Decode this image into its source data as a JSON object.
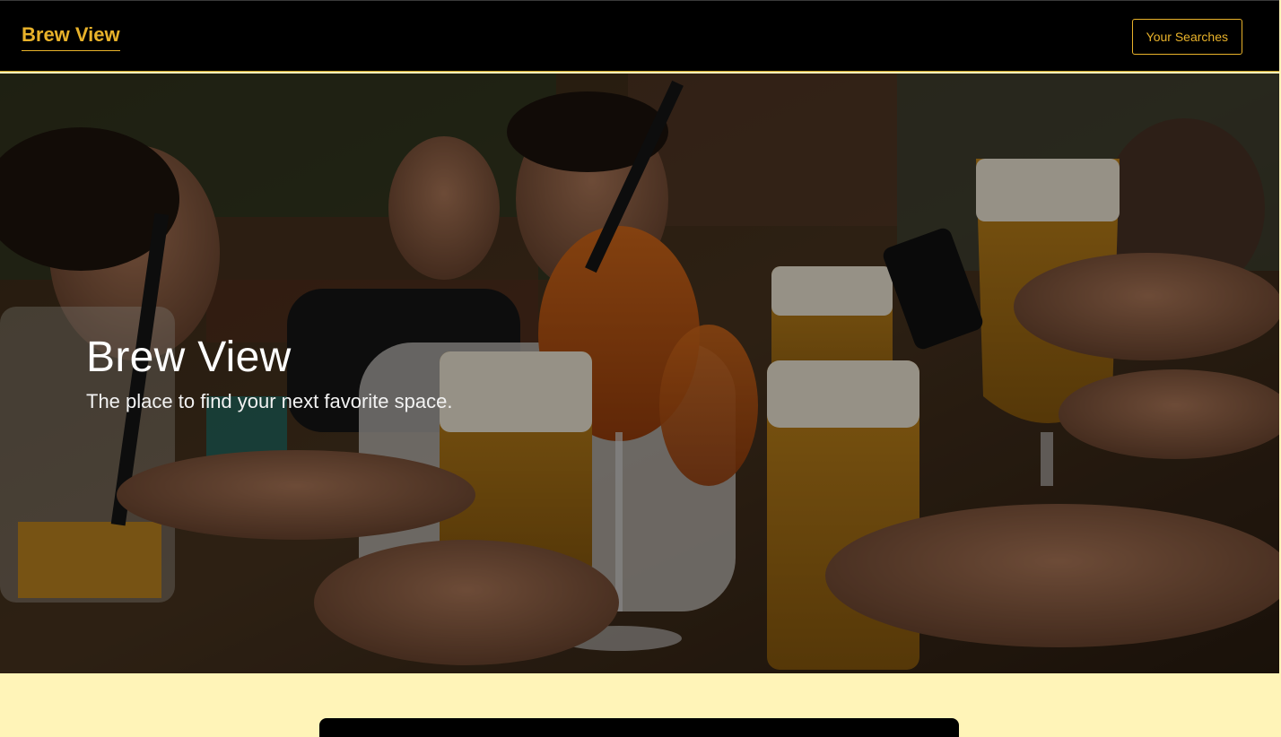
{
  "nav": {
    "brand": "Brew View",
    "searches_button": "Your Searches"
  },
  "hero": {
    "title": "Brew View",
    "subtitle": "The place to find your next favorite space."
  },
  "colors": {
    "accent": "#e8b22a",
    "navbar_bg": "#000000",
    "page_bg": "#fff4b8",
    "card_bg": "#000000"
  }
}
